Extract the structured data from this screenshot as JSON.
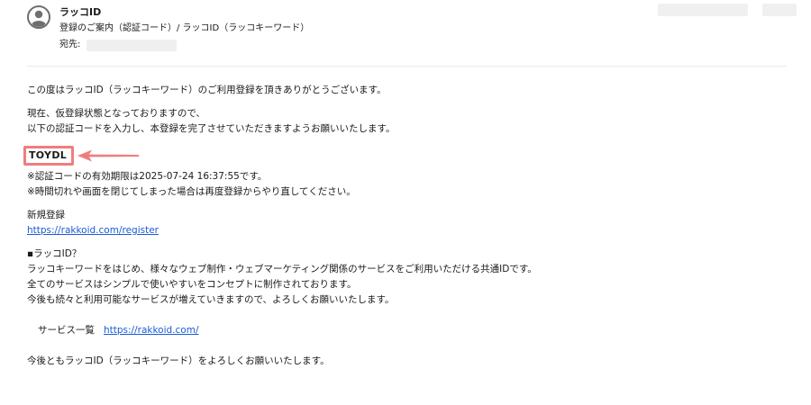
{
  "header": {
    "sender": "ラッコID",
    "subject": "登録のご案内（認証コード）/ ラッコID（ラッコキーワード）",
    "to_label": "宛先:"
  },
  "body": {
    "greeting": "この度はラッコID（ラッコキーワード）のご利用登録を頂きありがとうございます。",
    "status_line_1": "現在、仮登録状態となっておりますので、",
    "status_line_2": "以下の認証コードを入力し、本登録を完了させていただきますようお願いいたします。",
    "auth_code": "TOYDL",
    "expiry_note": "※認証コードの有効期限は2025-07-24 16:37:55です。",
    "retry_note": "※時間切れや画面を閉じてしまった場合は再度登録からやり直してください。",
    "register_label": "新規登録",
    "register_link": "https://rakkoid.com/register",
    "about_heading": "▪ラッコID？",
    "about_line_1": "ラッコキーワードをはじめ、様々なウェブ制作・ウェブマーケティング関係のサービスをご利用いただける共通IDです。",
    "about_line_2": "全てのサービスはシンプルで使いやすいをコンセプトに制作されております。",
    "about_line_3": "今後も続々と利用可能なサービスが増えていきますので、よろしくお願いいたします。",
    "services_label": "サービス一覧",
    "services_link": "https://rakkoid.com/",
    "closing": "今後ともラッコID（ラッコキーワード）をよろしくお願いいたします。"
  },
  "colors": {
    "highlight": "#f07d7d",
    "link": "#1a5bd6",
    "avatar": "#6f6f6f"
  },
  "icons": {
    "avatar": "user-avatar-icon",
    "annotation": "arrow-left-icon"
  }
}
